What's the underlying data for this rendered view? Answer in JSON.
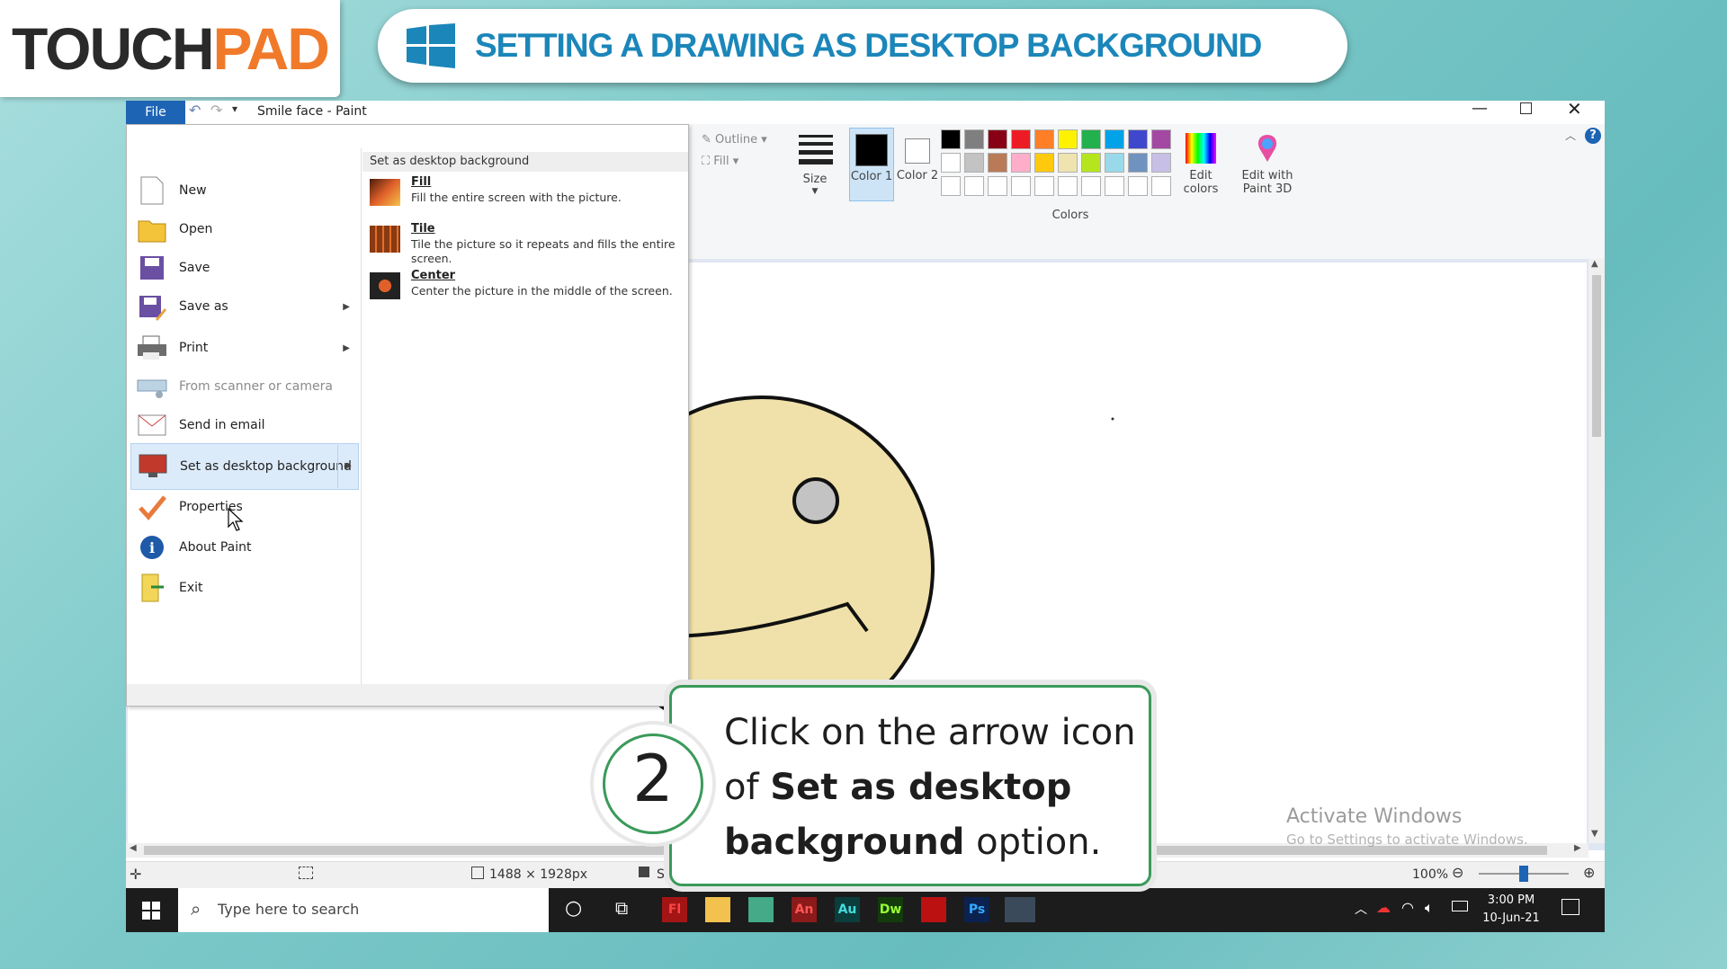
{
  "header": {
    "logo_part1": "TOUCH",
    "logo_part2": "PAD",
    "title": "SETTING A DRAWING AS DESKTOP BACKGROUND"
  },
  "window": {
    "title": "Smile face - Paint",
    "controls": [
      "minimize",
      "restore",
      "close"
    ]
  },
  "file_menu": {
    "tab_label": "File",
    "items": [
      {
        "label": "New",
        "icon": "new-file-icon",
        "submenu": false,
        "disabled": false
      },
      {
        "label": "Open",
        "icon": "open-folder-icon",
        "submenu": false,
        "disabled": false
      },
      {
        "label": "Save",
        "icon": "save-disk-icon",
        "submenu": false,
        "disabled": false
      },
      {
        "label": "Save as",
        "icon": "save-as-icon",
        "submenu": true,
        "disabled": false
      },
      {
        "label": "Print",
        "icon": "printer-icon",
        "submenu": true,
        "disabled": false
      },
      {
        "label": "From scanner or camera",
        "icon": "scanner-icon",
        "submenu": false,
        "disabled": true
      },
      {
        "label": "Send in email",
        "icon": "email-icon",
        "submenu": false,
        "disabled": false
      },
      {
        "label": "Set as desktop background",
        "icon": "desktop-background-icon",
        "submenu": true,
        "disabled": false,
        "highlighted": true
      },
      {
        "label": "Properties",
        "icon": "checkmark-icon",
        "submenu": false,
        "disabled": false
      },
      {
        "label": "About Paint",
        "icon": "info-icon",
        "submenu": false,
        "disabled": false
      },
      {
        "label": "Exit",
        "icon": "exit-icon",
        "submenu": false,
        "disabled": false
      }
    ],
    "submenu_title": "Set as desktop background",
    "submenu_options": [
      {
        "title": "Fill",
        "description": "Fill the entire screen with the picture."
      },
      {
        "title": "Tile",
        "description": "Tile the picture so it repeats and fills the entire screen."
      },
      {
        "title": "Center",
        "description": "Center the picture in the middle of the screen."
      }
    ]
  },
  "ribbon": {
    "outline_label": "Outline",
    "fill_label": "Fill",
    "size_label": "Size",
    "color1_label": "Color 1",
    "color2_label": "Color 2",
    "colors_group_label": "Colors",
    "edit_colors_label": "Edit colors",
    "edit_paint3d_label": "Edit with Paint 3D",
    "palette_row1": [
      "#000000",
      "#7f7f7f",
      "#880015",
      "#ed1c24",
      "#ff7f27",
      "#fff200",
      "#22b14c",
      "#00a2e8",
      "#3f48cc",
      "#a349a4"
    ],
    "palette_row2": [
      "#ffffff",
      "#c3c3c3",
      "#b97a57",
      "#ffaec9",
      "#ffc90e",
      "#efe4b0",
      "#b5e61d",
      "#99d9ea",
      "#7092be",
      "#c8bfe7"
    ]
  },
  "statusbar": {
    "dimensions": "1488 × 1928px",
    "size_truncated": "Si",
    "zoom": "100%",
    "zoom_level": 0.5
  },
  "watermark": {
    "line1": "Activate Windows",
    "line2": "Go to Settings to activate Windows."
  },
  "taskbar": {
    "search_placeholder": "Type here to search",
    "apps": [
      "Fl",
      "",
      "",
      "An",
      "Au",
      "Dw",
      "",
      "Ps",
      ""
    ],
    "time": "3:00 PM",
    "date": "10-Jun-21"
  },
  "callout": {
    "step": "2",
    "text_before": "Click on the arrow icon of ",
    "text_bold": "Set as desktop background",
    "text_after": " option."
  },
  "colors": {
    "accent_blue": "#1b86b9",
    "callout_green": "#3a9a5a",
    "face_fill": "#efe1a9"
  }
}
